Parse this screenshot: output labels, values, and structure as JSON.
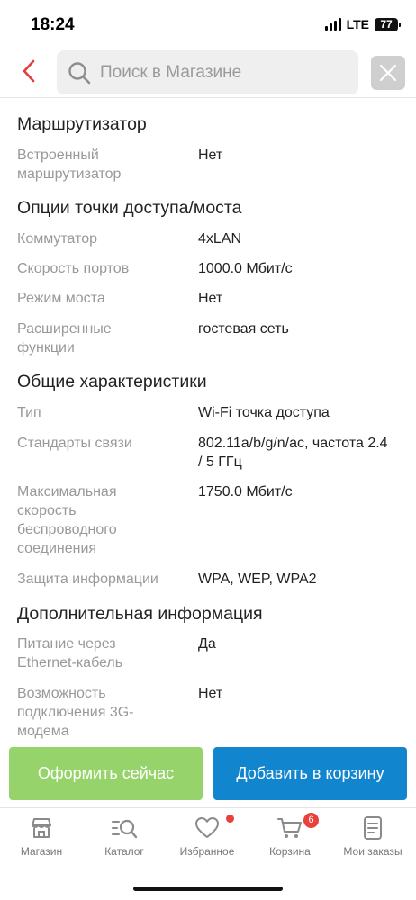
{
  "status_bar": {
    "time": "18:24",
    "network": "LTE",
    "battery": "77"
  },
  "search": {
    "placeholder": "Поиск в Магазине"
  },
  "sections": [
    {
      "title": "Маршрутизатор",
      "rows": [
        {
          "label": "Встроенный маршрутизатор",
          "value": "Нет"
        }
      ]
    },
    {
      "title": "Опции точки доступа/моста",
      "rows": [
        {
          "label": "Коммутатор",
          "value": "4xLAN"
        },
        {
          "label": "Скорость портов",
          "value": "1000.0 Мбит/с"
        },
        {
          "label": "Режим моста",
          "value": "Нет"
        },
        {
          "label": "Расширенные функции",
          "value": "гостевая сеть"
        }
      ]
    },
    {
      "title": "Общие характеристики",
      "rows": [
        {
          "label": "Тип",
          "value": "Wi-Fi точка доступа"
        },
        {
          "label": "Стандарты связи",
          "value": "802.11a/b/g/n/ac, частота 2.4 / 5 ГГц"
        },
        {
          "label": "Максимальная скорость беспроводного соединения",
          "value": "1750.0 Мбит/с"
        },
        {
          "label": "Защита информации",
          "value": "WPA, WEP, WPA2"
        }
      ]
    },
    {
      "title": "Дополнительная информация",
      "rows": [
        {
          "label": "Питание через Ethernet-кабель",
          "value": "Да"
        },
        {
          "label": "Возможность подключения 3G-модема",
          "value": "Нет"
        }
      ]
    }
  ],
  "actions": {
    "checkout": "Оформить сейчас",
    "add_to_cart": "Добавить в корзину"
  },
  "nav": [
    {
      "label": "Магазин",
      "icon": "store-icon"
    },
    {
      "label": "Каталог",
      "icon": "catalog-search-icon"
    },
    {
      "label": "Избранное",
      "icon": "heart-icon"
    },
    {
      "label": "Корзина",
      "icon": "cart-icon",
      "badge": "6"
    },
    {
      "label": "Мои заказы",
      "icon": "orders-icon"
    }
  ],
  "colors": {
    "accent_green": "#96d36b",
    "accent_blue": "#1285cf",
    "back_red": "#e0413a",
    "badge_red": "#e8423b"
  }
}
